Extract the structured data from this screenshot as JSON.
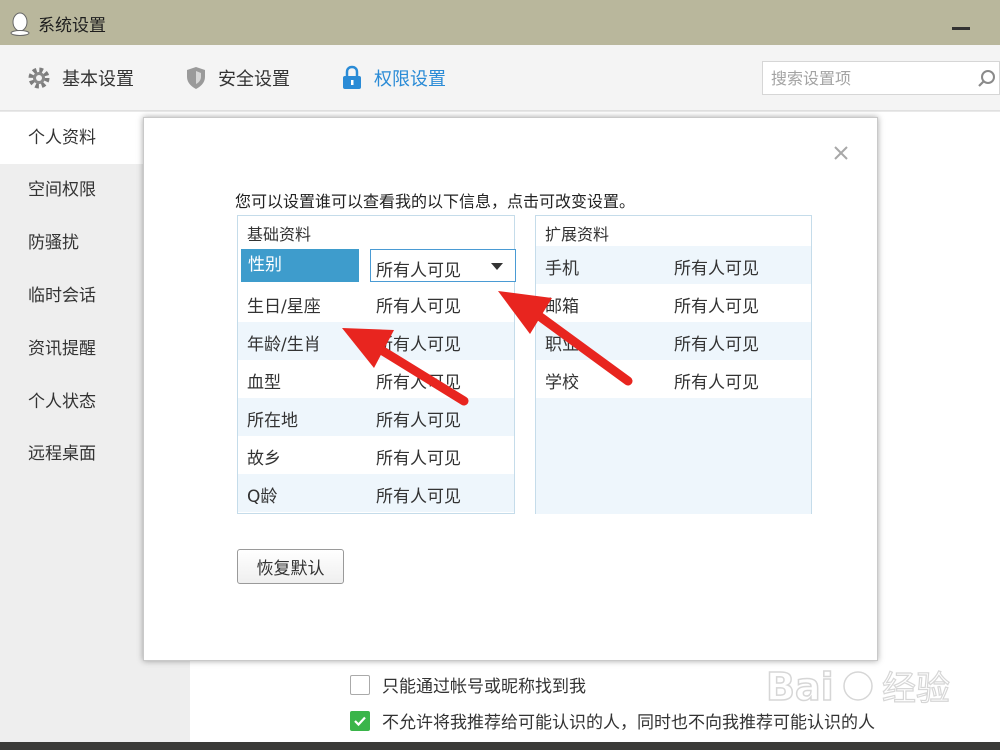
{
  "window": {
    "title": "系统设置"
  },
  "toolbar": {
    "items": [
      {
        "label": "基本设置",
        "icon": "gear-icon"
      },
      {
        "label": "安全设置",
        "icon": "shield-icon"
      },
      {
        "label": "权限设置",
        "icon": "lock-icon",
        "active": true
      }
    ],
    "search_placeholder": "搜索设置项"
  },
  "sidebar": {
    "items": [
      {
        "label": "个人资料",
        "active": true
      },
      {
        "label": "空间权限"
      },
      {
        "label": "防骚扰"
      },
      {
        "label": "临时会话"
      },
      {
        "label": "资讯提醒"
      },
      {
        "label": "个人状态"
      },
      {
        "label": "远程桌面"
      }
    ]
  },
  "dialog": {
    "description": "您可以设置谁可以查看我的以下信息，点击可改变设置。",
    "basic": {
      "title": "基础资料",
      "rows": [
        {
          "key": "性别",
          "value": "所有人可见"
        },
        {
          "key": "生日/星座",
          "value": "所有人可见"
        },
        {
          "key": "年龄/生肖",
          "value": "所有人可见"
        },
        {
          "key": "血型",
          "value": "所有人可见"
        },
        {
          "key": "所在地",
          "value": "所有人可见"
        },
        {
          "key": "故乡",
          "value": "所有人可见"
        },
        {
          "key": "Q龄",
          "value": "所有人可见"
        }
      ]
    },
    "extended": {
      "title": "扩展资料",
      "rows": [
        {
          "key": "手机",
          "value": "所有人可见"
        },
        {
          "key": "邮箱",
          "value": "所有人可见"
        },
        {
          "key": "职业",
          "value": "所有人可见"
        },
        {
          "key": "学校",
          "value": "所有人可见"
        }
      ]
    },
    "restore_label": "恢复默认"
  },
  "footer": {
    "option1": "只能通过帐号或昵称找到我",
    "option2": "不允许将我推荐给可能认识的人，同时也不向我推荐可能认识的人"
  },
  "colors": {
    "accent": "#2a8bd6",
    "selected": "#3e9ccc",
    "arrow": "#e8251f",
    "check": "#3ab54a"
  }
}
